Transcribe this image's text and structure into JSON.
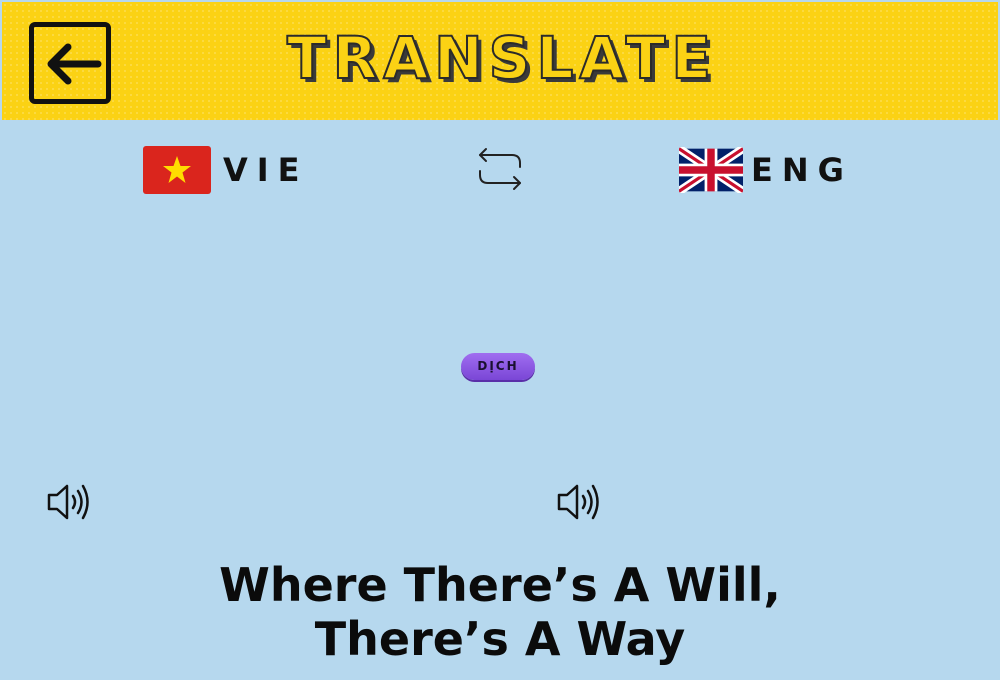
{
  "header": {
    "title": "TRANSLATE",
    "background_color": "#fbd214",
    "back_icon": "exit-arrow-left-icon"
  },
  "languages": {
    "source": {
      "code": "VIE",
      "flag": "vietnam-flag-icon"
    },
    "target": {
      "code": "ENG",
      "flag": "uk-flag-icon"
    },
    "swap_icon": "swap-arrows-icon"
  },
  "action": {
    "translate_label": "DỊCH"
  },
  "speakers": {
    "source_icon": "speaker-volume-icon",
    "target_icon": "speaker-volume-icon"
  },
  "quote": {
    "line1": "Where There’s A Will,",
    "line2": "There’s A Way"
  },
  "colors": {
    "background": "#b6d8ee",
    "button": "#8a55e0"
  }
}
